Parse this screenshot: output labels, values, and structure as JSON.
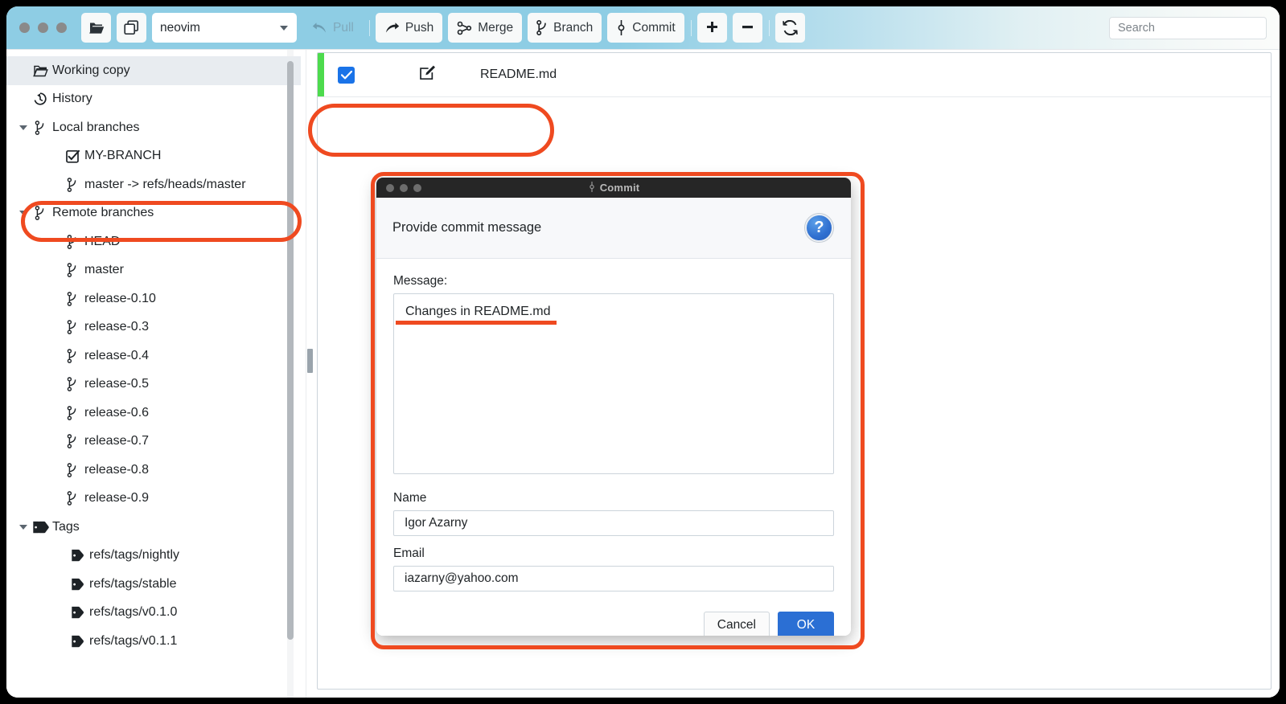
{
  "toolbar": {
    "open_repo_icon": "open-folder-icon",
    "clone_repo_icon": "copy-repo-icon",
    "repo_name": "neovim",
    "buttons": [
      {
        "label": "Pull",
        "icon": "pull-arrow-icon",
        "disabled": true
      },
      {
        "label": "Push",
        "icon": "push-arrow-icon",
        "disabled": false
      },
      {
        "label": "Merge",
        "icon": "merge-icon",
        "disabled": false
      },
      {
        "label": "Branch",
        "icon": "branch-icon",
        "disabled": false
      },
      {
        "label": "Commit",
        "icon": "commit-icon",
        "disabled": false
      }
    ],
    "add_label": "+",
    "remove_label": "−",
    "refresh_icon": "refresh-icon"
  },
  "search": {
    "placeholder": "Search",
    "value": ""
  },
  "sidebar": {
    "items": [
      {
        "label": "Working copy",
        "icon": "folder-icon",
        "indent": 1,
        "twisty": "",
        "selected": true
      },
      {
        "label": "History",
        "icon": "history-icon",
        "indent": 1,
        "twisty": "",
        "selected": false
      },
      {
        "label": "Local branches",
        "icon": "branch-icon",
        "indent": 1,
        "twisty": "down",
        "selected": false
      },
      {
        "label": "MY-BRANCH",
        "icon": "checked-branch-icon",
        "indent": 2,
        "twisty": "",
        "selected": false
      },
      {
        "label": "master -> refs/heads/master",
        "icon": "branch-icon",
        "indent": 2,
        "twisty": "",
        "selected": false
      },
      {
        "label": "Remote branches",
        "icon": "branch-icon",
        "indent": 1,
        "twisty": "down",
        "selected": false
      },
      {
        "label": "HEAD",
        "icon": "branch-icon",
        "indent": 2,
        "twisty": "",
        "selected": false
      },
      {
        "label": "master",
        "icon": "branch-icon",
        "indent": 2,
        "twisty": "",
        "selected": false
      },
      {
        "label": "release-0.10",
        "icon": "branch-icon",
        "indent": 2,
        "twisty": "",
        "selected": false
      },
      {
        "label": "release-0.3",
        "icon": "branch-icon",
        "indent": 2,
        "twisty": "",
        "selected": false
      },
      {
        "label": "release-0.4",
        "icon": "branch-icon",
        "indent": 2,
        "twisty": "",
        "selected": false
      },
      {
        "label": "release-0.5",
        "icon": "branch-icon",
        "indent": 2,
        "twisty": "",
        "selected": false
      },
      {
        "label": "release-0.6",
        "icon": "branch-icon",
        "indent": 2,
        "twisty": "",
        "selected": false
      },
      {
        "label": "release-0.7",
        "icon": "branch-icon",
        "indent": 2,
        "twisty": "",
        "selected": false
      },
      {
        "label": "release-0.8",
        "icon": "branch-icon",
        "indent": 2,
        "twisty": "",
        "selected": false
      },
      {
        "label": "release-0.9",
        "icon": "branch-icon",
        "indent": 2,
        "twisty": "",
        "selected": false
      },
      {
        "label": "Tags",
        "icon": "tags-icon",
        "indent": 1,
        "twisty": "down",
        "selected": false
      },
      {
        "label": "refs/tags/nightly",
        "icon": "tag-icon",
        "indent": 2,
        "twisty": "",
        "selected": false
      },
      {
        "label": "refs/tags/stable",
        "icon": "tag-icon",
        "indent": 2,
        "twisty": "",
        "selected": false
      },
      {
        "label": "refs/tags/v0.1.0",
        "icon": "tag-icon",
        "indent": 2,
        "twisty": "",
        "selected": false
      },
      {
        "label": "refs/tags/v0.1.1",
        "icon": "tag-icon",
        "indent": 2,
        "twisty": "",
        "selected": false
      }
    ]
  },
  "file_list": {
    "rows": [
      {
        "name": "README.md",
        "checked": true,
        "status_color": "#4ddb4d",
        "status_icon": "modified-pencil-icon"
      }
    ]
  },
  "commit_dialog": {
    "window_title": "Commit",
    "title_icon": "commit-icon",
    "header_text": "Provide commit message",
    "help_label": "?",
    "message_label": "Message:",
    "message_value": "Changes in README.md",
    "name_label": "Name",
    "name_value": "Igor Azarny",
    "email_label": "Email",
    "email_value": "iazarny@yahoo.com",
    "cancel_label": "Cancel",
    "ok_label": "OK"
  },
  "annotations": {
    "accent_color": "#ef4a20",
    "targets": [
      "sidebar-branch-my-branch",
      "file-row-readme",
      "commit-dialog",
      "commit-message-text"
    ]
  }
}
